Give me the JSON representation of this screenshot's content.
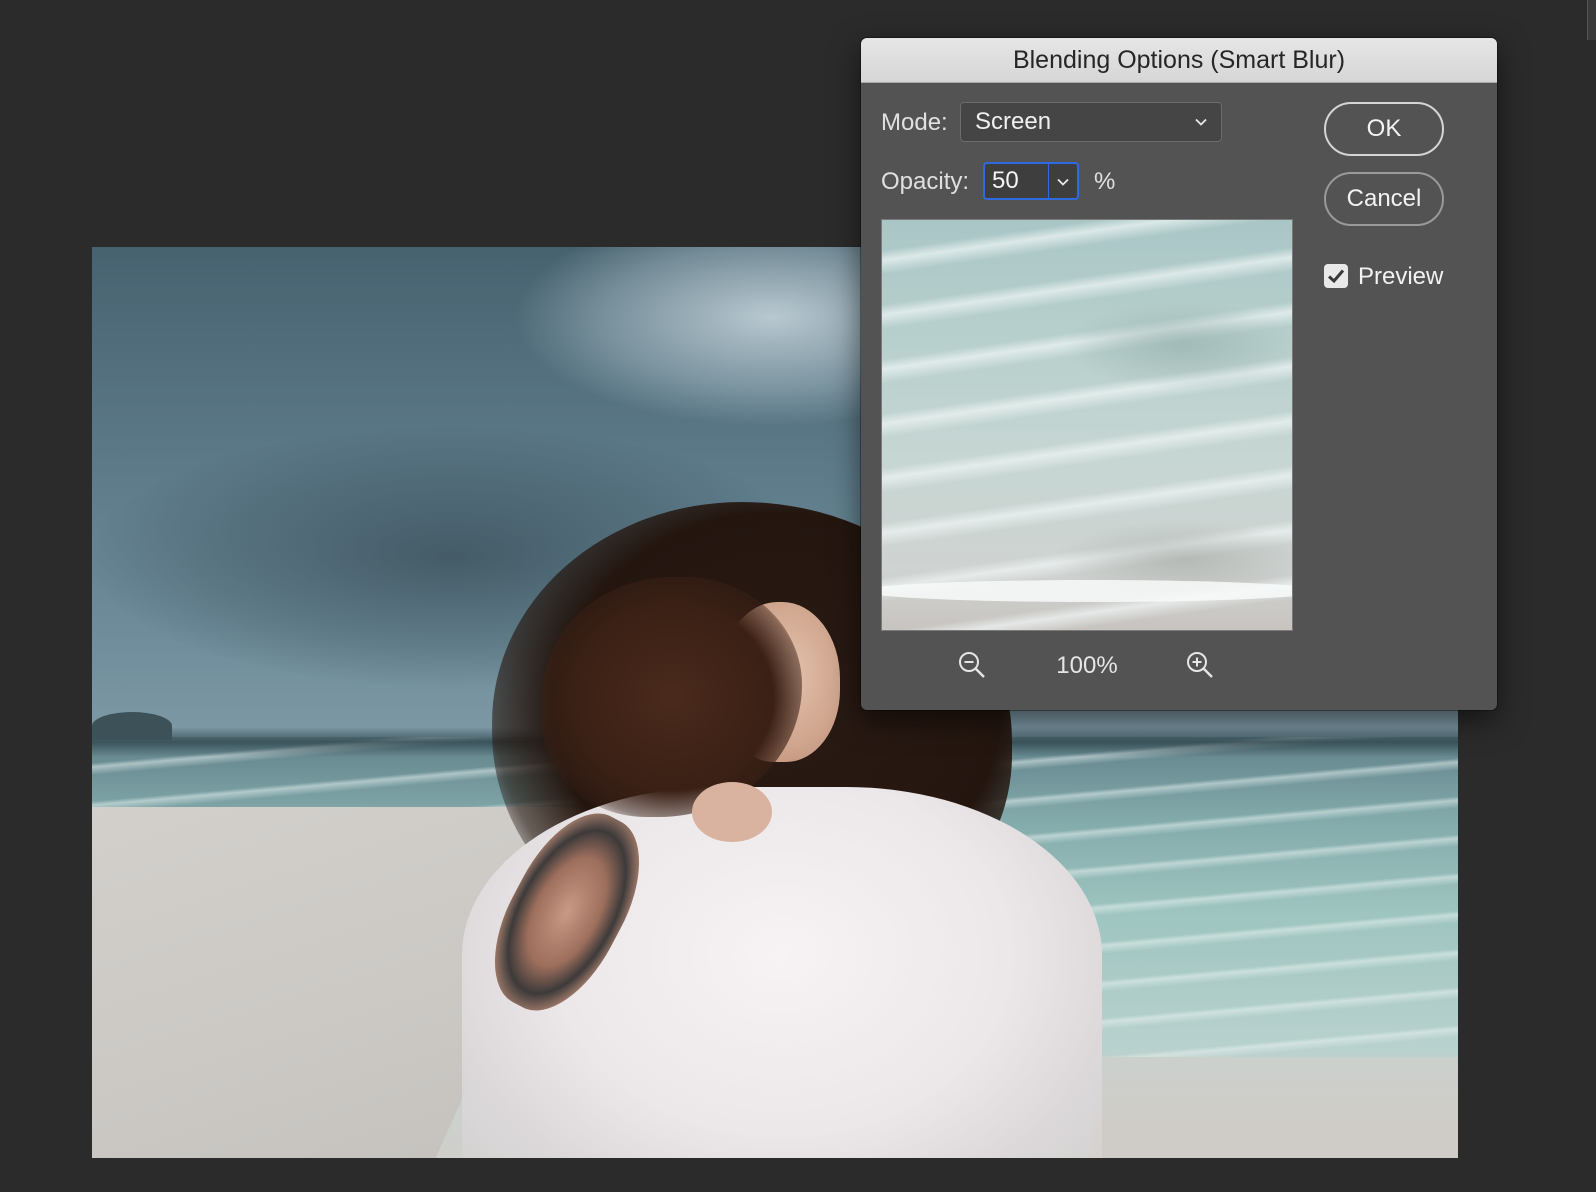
{
  "dialog": {
    "title": "Blending Options (Smart Blur)",
    "mode_label": "Mode:",
    "mode_value": "Screen",
    "opacity_label": "Opacity:",
    "opacity_value": "50",
    "opacity_unit": "%",
    "zoom_level": "100%",
    "ok_label": "OK",
    "cancel_label": "Cancel",
    "preview_label": "Preview",
    "preview_checked": true,
    "icons": {
      "mode_dropdown": "chevron-down-icon",
      "opacity_dropdown": "chevron-down-icon",
      "zoom_out": "zoom-out-icon",
      "zoom_in": "zoom-in-icon",
      "preview_check": "checkmark-icon"
    }
  },
  "colors": {
    "app_background": "#2b2b2b",
    "dialog_background": "#535353",
    "focus_accent": "#2e6be0"
  }
}
